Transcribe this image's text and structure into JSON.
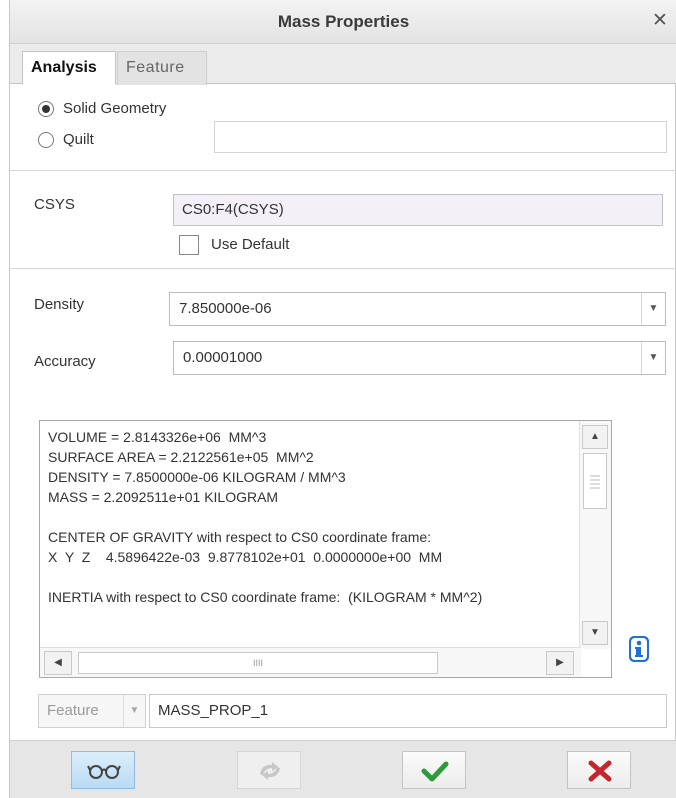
{
  "window": {
    "title": "Mass Properties",
    "close_glyph": "✕"
  },
  "tabs": [
    {
      "label": "Analysis",
      "active": true
    },
    {
      "label": "Feature",
      "active": false
    }
  ],
  "geometry": {
    "options": [
      {
        "label": "Solid Geometry",
        "selected": true
      },
      {
        "label": "Quilt",
        "selected": false
      }
    ],
    "quilt_value": ""
  },
  "csys": {
    "label": "CSYS",
    "value": "CS0:F4(CSYS)",
    "use_default_label": "Use Default",
    "use_default_checked": false
  },
  "density": {
    "label": "Density",
    "value": "7.850000e-06"
  },
  "accuracy": {
    "label": "Accuracy",
    "value": "0.00001000"
  },
  "results": {
    "lines": [
      "VOLUME = 2.8143326e+06  MM^3",
      "SURFACE AREA = 2.2122561e+05  MM^2",
      "DENSITY = 7.8500000e-06 KILOGRAM / MM^3",
      "MASS = 2.2092511e+01 KILOGRAM",
      "",
      "CENTER OF GRAVITY with respect to CS0 coordinate frame:",
      "X  Y  Z    4.5896422e-03  9.8778102e+01  0.0000000e+00  MM",
      "",
      "INERTIA with respect to CS0 coordinate frame:  (KILOGRAM * MM^2)"
    ],
    "hscroll_grip": "IIII"
  },
  "feature_bar": {
    "type_label": "Feature",
    "name_value": "MASS_PROP_1"
  },
  "icons": {
    "info": "info-icon",
    "preview": "glasses-icon",
    "repeat": "repeat-icon",
    "ok": "checkmark-icon",
    "cancel": "cancel-x-icon"
  },
  "colors": {
    "info_blue": "#1f6fd6",
    "ok_green": "#2e9a3a",
    "cancel_red": "#c1272d",
    "active_button": "#b9daf4"
  }
}
